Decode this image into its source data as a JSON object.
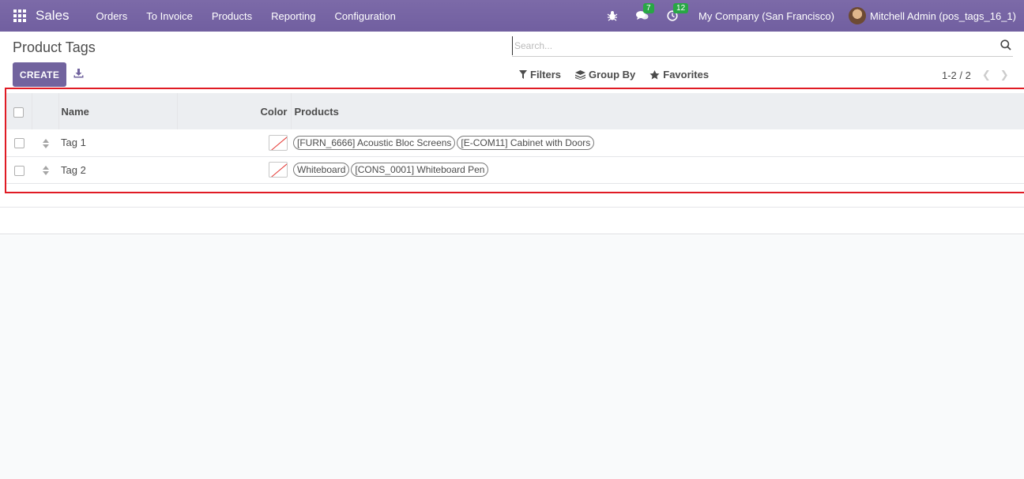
{
  "navbar": {
    "brand": "Sales",
    "menu": [
      "Orders",
      "To Invoice",
      "Products",
      "Reporting",
      "Configuration"
    ],
    "messages_count": "7",
    "activities_count": "12",
    "company": "My Company (San Francisco)",
    "user": "Mitchell Admin (pos_tags_16_1)"
  },
  "control": {
    "title": "Product Tags",
    "create_label": "CREATE",
    "search_placeholder": "Search...",
    "filters_label": "Filters",
    "group_by_label": "Group By",
    "favorites_label": "Favorites",
    "pager": "1-2 / 2"
  },
  "list": {
    "headers": {
      "name": "Name",
      "color": "Color",
      "products": "Products"
    },
    "rows": [
      {
        "name": "Tag 1",
        "products": [
          "[FURN_6666] Acoustic Bloc Screens",
          "[E-COM11] Cabinet with Doors"
        ]
      },
      {
        "name": "Tag 2",
        "products": [
          "Whiteboard",
          "[CONS_0001] Whiteboard Pen"
        ]
      }
    ]
  },
  "colors": {
    "navbar": "#7c6aa8",
    "primary": "#71639e",
    "badge": "#28a745",
    "highlight": "#e01b24"
  }
}
